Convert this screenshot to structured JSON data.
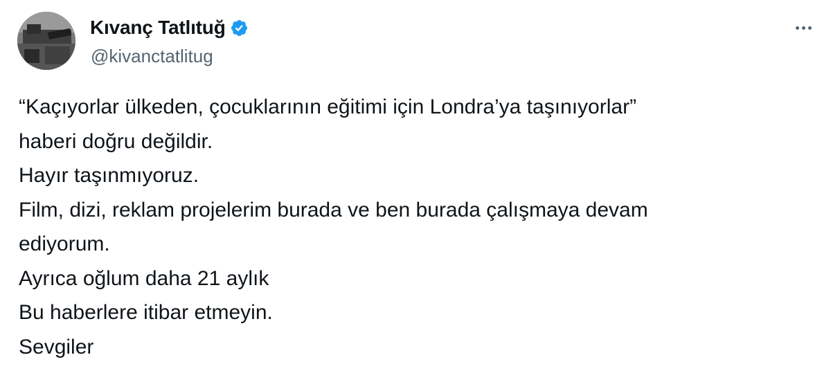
{
  "author": {
    "display_name": "Kıvanç Tatlıtuğ",
    "handle": "@kivanctatlitug",
    "verified": true,
    "verified_color": "#1d9bf0"
  },
  "more_icon": "more-horizontal-icon",
  "tweet": {
    "lines": [
      "“Kaçıyorlar ülkeden, çocuklarının eğitimi için Londra’ya taşınıyorlar”",
      "haberi doğru değildir.",
      "Hayır taşınmıyoruz.",
      "Film, dizi, reklam projelerim burada ve ben burada çalışmaya devam",
      "ediyorum.",
      "Ayrıca oğlum daha 21 aylık",
      "Bu haberlere itibar etmeyin.",
      "Sevgiler"
    ]
  }
}
